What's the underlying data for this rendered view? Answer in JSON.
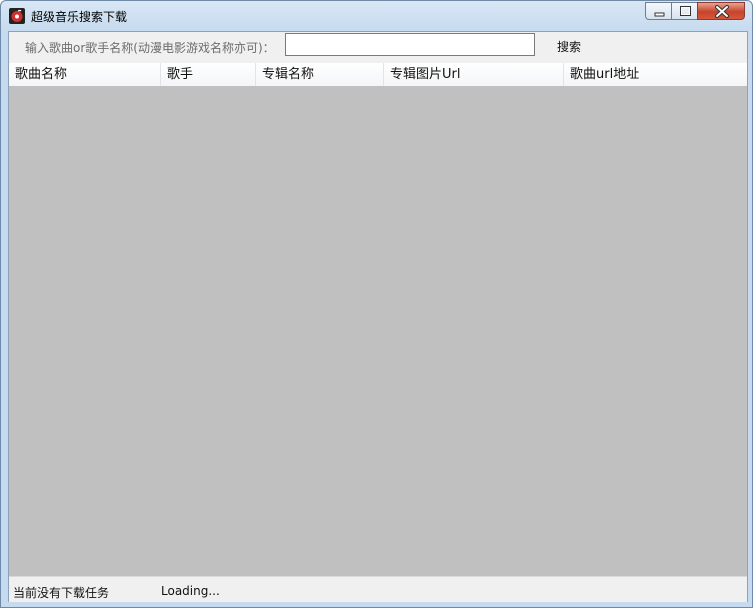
{
  "window": {
    "title": "超级音乐搜索下载",
    "icon": "music-app-icon",
    "controls": [
      "minimize-icon",
      "maximize-icon",
      "close-icon"
    ]
  },
  "search": {
    "label": "输入歌曲or歌手名称(动漫电影游戏名称亦可)：",
    "value": "",
    "placeholder": "",
    "button_label": "搜索"
  },
  "table": {
    "columns": [
      "歌曲名称",
      "歌手",
      "专辑名称",
      "专辑图片Url",
      "歌曲url地址"
    ],
    "rows": []
  },
  "status": {
    "download_status": "当前没有下载任务",
    "loading": "Loading..."
  },
  "colors": {
    "list_background": "#c0c0c0",
    "window_frame": "#c6dbef",
    "close_button": "#c7432b"
  }
}
